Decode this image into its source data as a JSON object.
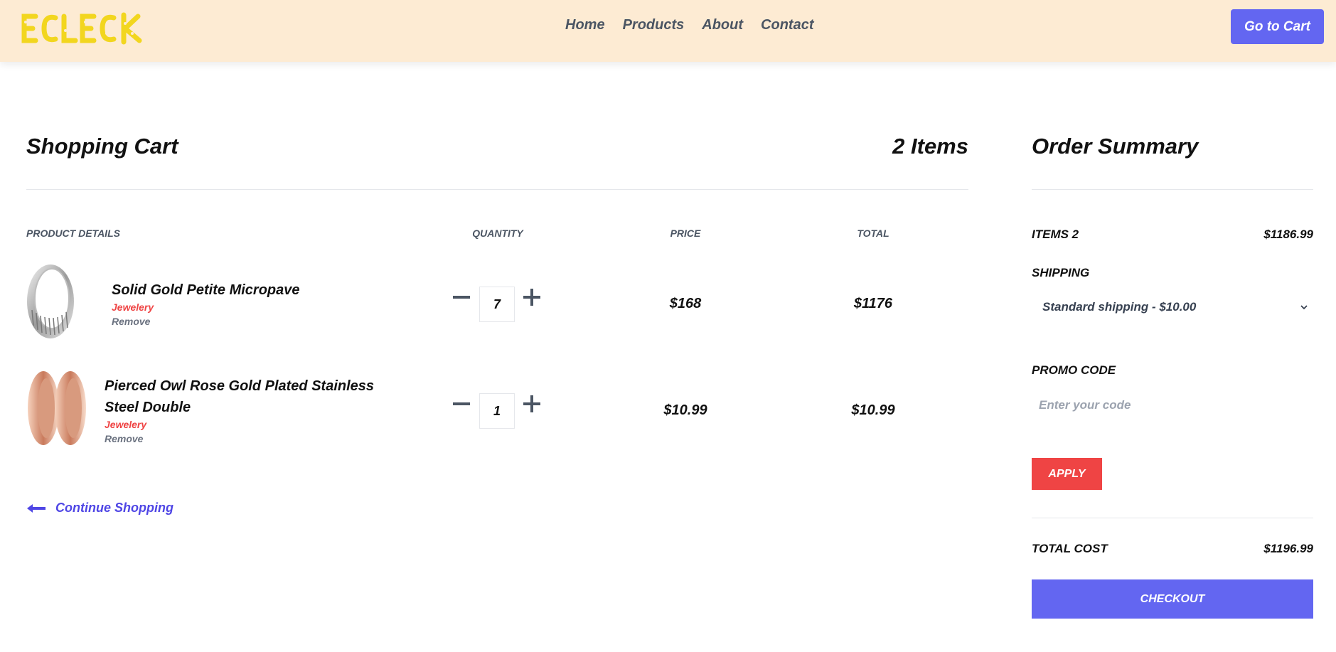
{
  "header": {
    "logo_text": "ECLECK",
    "nav": [
      {
        "label": "Home"
      },
      {
        "label": "Products"
      },
      {
        "label": "About"
      },
      {
        "label": "Contact"
      }
    ],
    "cart_button": "Go to Cart"
  },
  "cart": {
    "title": "Shopping Cart",
    "item_count": "2 Items",
    "columns": {
      "details": "PRODUCT DETAILS",
      "quantity": "QUANTITY",
      "price": "PRICE",
      "total": "TOTAL"
    },
    "items": [
      {
        "name": "Solid Gold Petite Micropave",
        "category": "Jewelery",
        "remove": "Remove",
        "quantity": "7",
        "price": "$168",
        "total": "$1176",
        "image_icon": "silver-ring-icon"
      },
      {
        "name": "Pierced Owl Rose Gold Plated Stainless Steel Double",
        "category": "Jewelery",
        "remove": "Remove",
        "quantity": "1",
        "price": "$10.99",
        "total": "$10.99",
        "image_icon": "rose-gold-tunnel-plugs-icon"
      }
    ],
    "continue_label": "Continue Shopping"
  },
  "summary": {
    "title": "Order Summary",
    "items_label": "ITEMS 2",
    "items_value": "$1186.99",
    "shipping_label": "SHIPPING",
    "shipping_selected": "Standard shipping - $10.00",
    "promo_label": "PROMO CODE",
    "promo_placeholder": "Enter your code",
    "apply_label": "APPLY",
    "total_label": "TOTAL COST",
    "total_value": "$1196.99",
    "checkout_label": "CHECKOUT"
  },
  "colors": {
    "header_bg": "#fdebd3",
    "accent": "#6366f1",
    "danger": "#ef4444",
    "logo": "#f2d61f"
  }
}
